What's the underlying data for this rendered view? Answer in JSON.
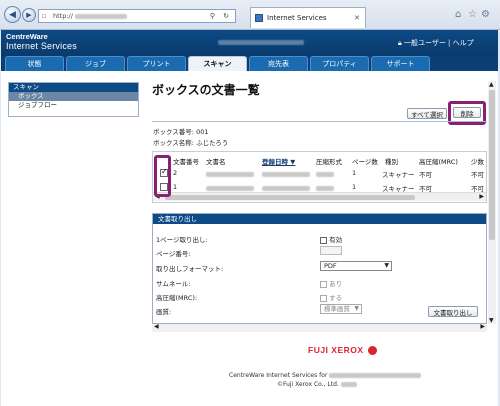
{
  "browser": {
    "url": "http://",
    "tab_title": "Internet Services",
    "back_icon": "back-arrow-icon",
    "forward_icon": "forward-arrow-icon"
  },
  "header": {
    "logo_line1": "CentreWare",
    "logo_line2": "Internet Services",
    "user_label": "一般ユーザー | ヘルプ"
  },
  "tabs": [
    {
      "label": "状態",
      "active": false
    },
    {
      "label": "ジョブ",
      "active": false
    },
    {
      "label": "プリント",
      "active": false
    },
    {
      "label": "スキャン",
      "active": true
    },
    {
      "label": "宛先表",
      "active": false
    },
    {
      "label": "プロパティ",
      "active": false
    },
    {
      "label": "サポート",
      "active": false
    }
  ],
  "sidebar": {
    "title": "スキャン",
    "items": [
      {
        "label": "ボックス",
        "selected": true
      },
      {
        "label": "ジョブフロー",
        "selected": false
      }
    ]
  },
  "main": {
    "title": "ボックスの文書一覧",
    "select_all_label": "すべて選択",
    "delete_label": "削除",
    "box_number_label": "ボックス番号:",
    "box_number_value": "001",
    "box_name_label": "ボックス名称:",
    "box_name_value": "ふじたろう",
    "table": {
      "headers": [
        "文書番号",
        "文書名",
        "登録日時 ▼",
        "圧縮形式",
        "ページ数",
        "種別",
        "高圧縮(MRC)",
        "少数"
      ],
      "rows": [
        {
          "checked": true,
          "number": "2",
          "format": "",
          "pages": "1",
          "type": "スキャナー",
          "mrc": "不可",
          "few": "不可"
        },
        {
          "checked": false,
          "number": "1",
          "format": "",
          "pages": "1",
          "type": "スキャナー",
          "mrc": "不可",
          "few": "不可"
        }
      ]
    }
  },
  "extract": {
    "title": "文書取り出し",
    "one_page_label": "1ページ取り出し:",
    "one_page_option": "有効",
    "page_number_label": "ページ番号:",
    "format_label": "取り出しフォーマット:",
    "format_value": "PDF",
    "thumbnail_label": "サムネール:",
    "thumbnail_option": "あり",
    "mrc_label": "高圧縮(MRC):",
    "mrc_option": "する",
    "quality_label": "画質:",
    "quality_value": "標準画質",
    "extract_button": "文書取り出し"
  },
  "footer": {
    "brand": "FUJI XEROX",
    "line1": "CentreWare Internet Services for",
    "line2": "©Fuji Xerox Co., Ltd."
  },
  "colors": {
    "header_bg": "#0d4a86",
    "highlight": "#8a1f76",
    "brand_red": "#d8252e"
  }
}
